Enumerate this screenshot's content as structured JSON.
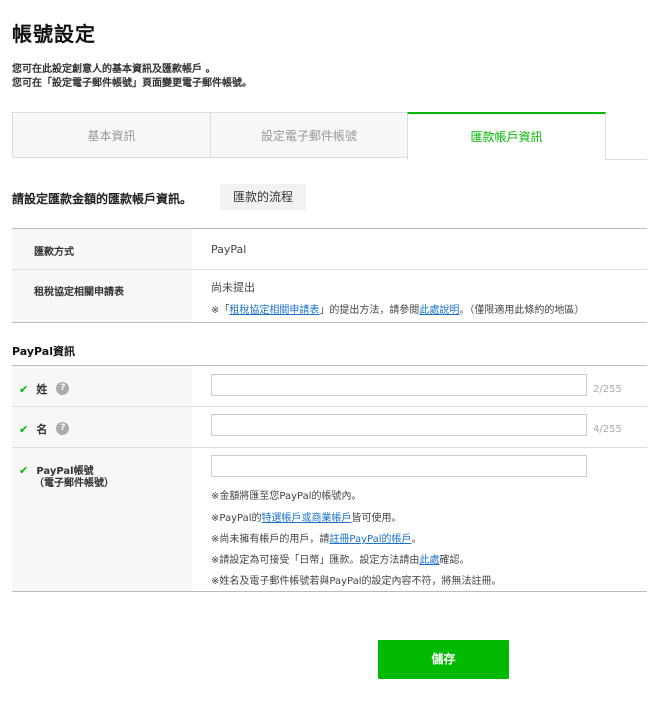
{
  "page": {
    "title": "帳號設定",
    "description_line1": "您可在此設定創意人的基本資訊及匯款帳戶 。",
    "description_line2": "您可在「設定電子郵件帳號」頁面變更電子郵件帳號。"
  },
  "tabs": [
    {
      "label": "基本資訊",
      "active": false
    },
    {
      "label": "設定電子郵件帳號",
      "active": false
    },
    {
      "label": "匯款帳戶資訊",
      "active": true
    }
  ],
  "intro": {
    "text": "請設定匯款金額的匯款帳戶資訊。",
    "flow_button": "匯款的流程"
  },
  "payment_table": {
    "method_label": "匯款方式",
    "method_value": "PayPal",
    "tax_label": "租稅協定相關申請表",
    "tax_status": "尚未提出",
    "tax_note_prefix": "※「",
    "tax_note_link": "租稅協定相關申請表",
    "tax_note_mid": "」的提出方法，請參閱",
    "tax_note_link2": "此處說明",
    "tax_note_suffix": "。（僅限適用此條約的地區）"
  },
  "paypal": {
    "section_title": "PayPal資訊",
    "check_mark": "✔",
    "help_mark": "?",
    "last_name_label": "姓",
    "last_name_value": "",
    "last_name_counter": "2/255",
    "first_name_label": "名",
    "first_name_value": "",
    "first_name_counter": "4/255",
    "account_label_line1": "PayPal帳號",
    "account_label_line2": "（電子郵件帳號）",
    "account_value": "",
    "notes": {
      "n1": "※金額將匯至您PayPal的帳號內。",
      "n2_prefix": "※PayPal的",
      "n2_link": "特選帳戶或商業帳戶",
      "n2_suffix": "皆可使用。",
      "n3_prefix": "※尚未擁有帳戶的用戶，請",
      "n3_link": "註冊PayPal的帳戶",
      "n3_suffix": "。",
      "n4_prefix": "※請設定為可接受「日幣」匯款。設定方法請由",
      "n4_link": "此處",
      "n4_suffix": "確認。",
      "n5": "※姓名及電子郵件帳號若與PayPal的設定內容不符，將無法註冊。"
    }
  },
  "save_button": "儲存",
  "colors": {
    "accent": "#00b900",
    "link": "#1a73c9",
    "label_bg": "#f7f7f7"
  }
}
